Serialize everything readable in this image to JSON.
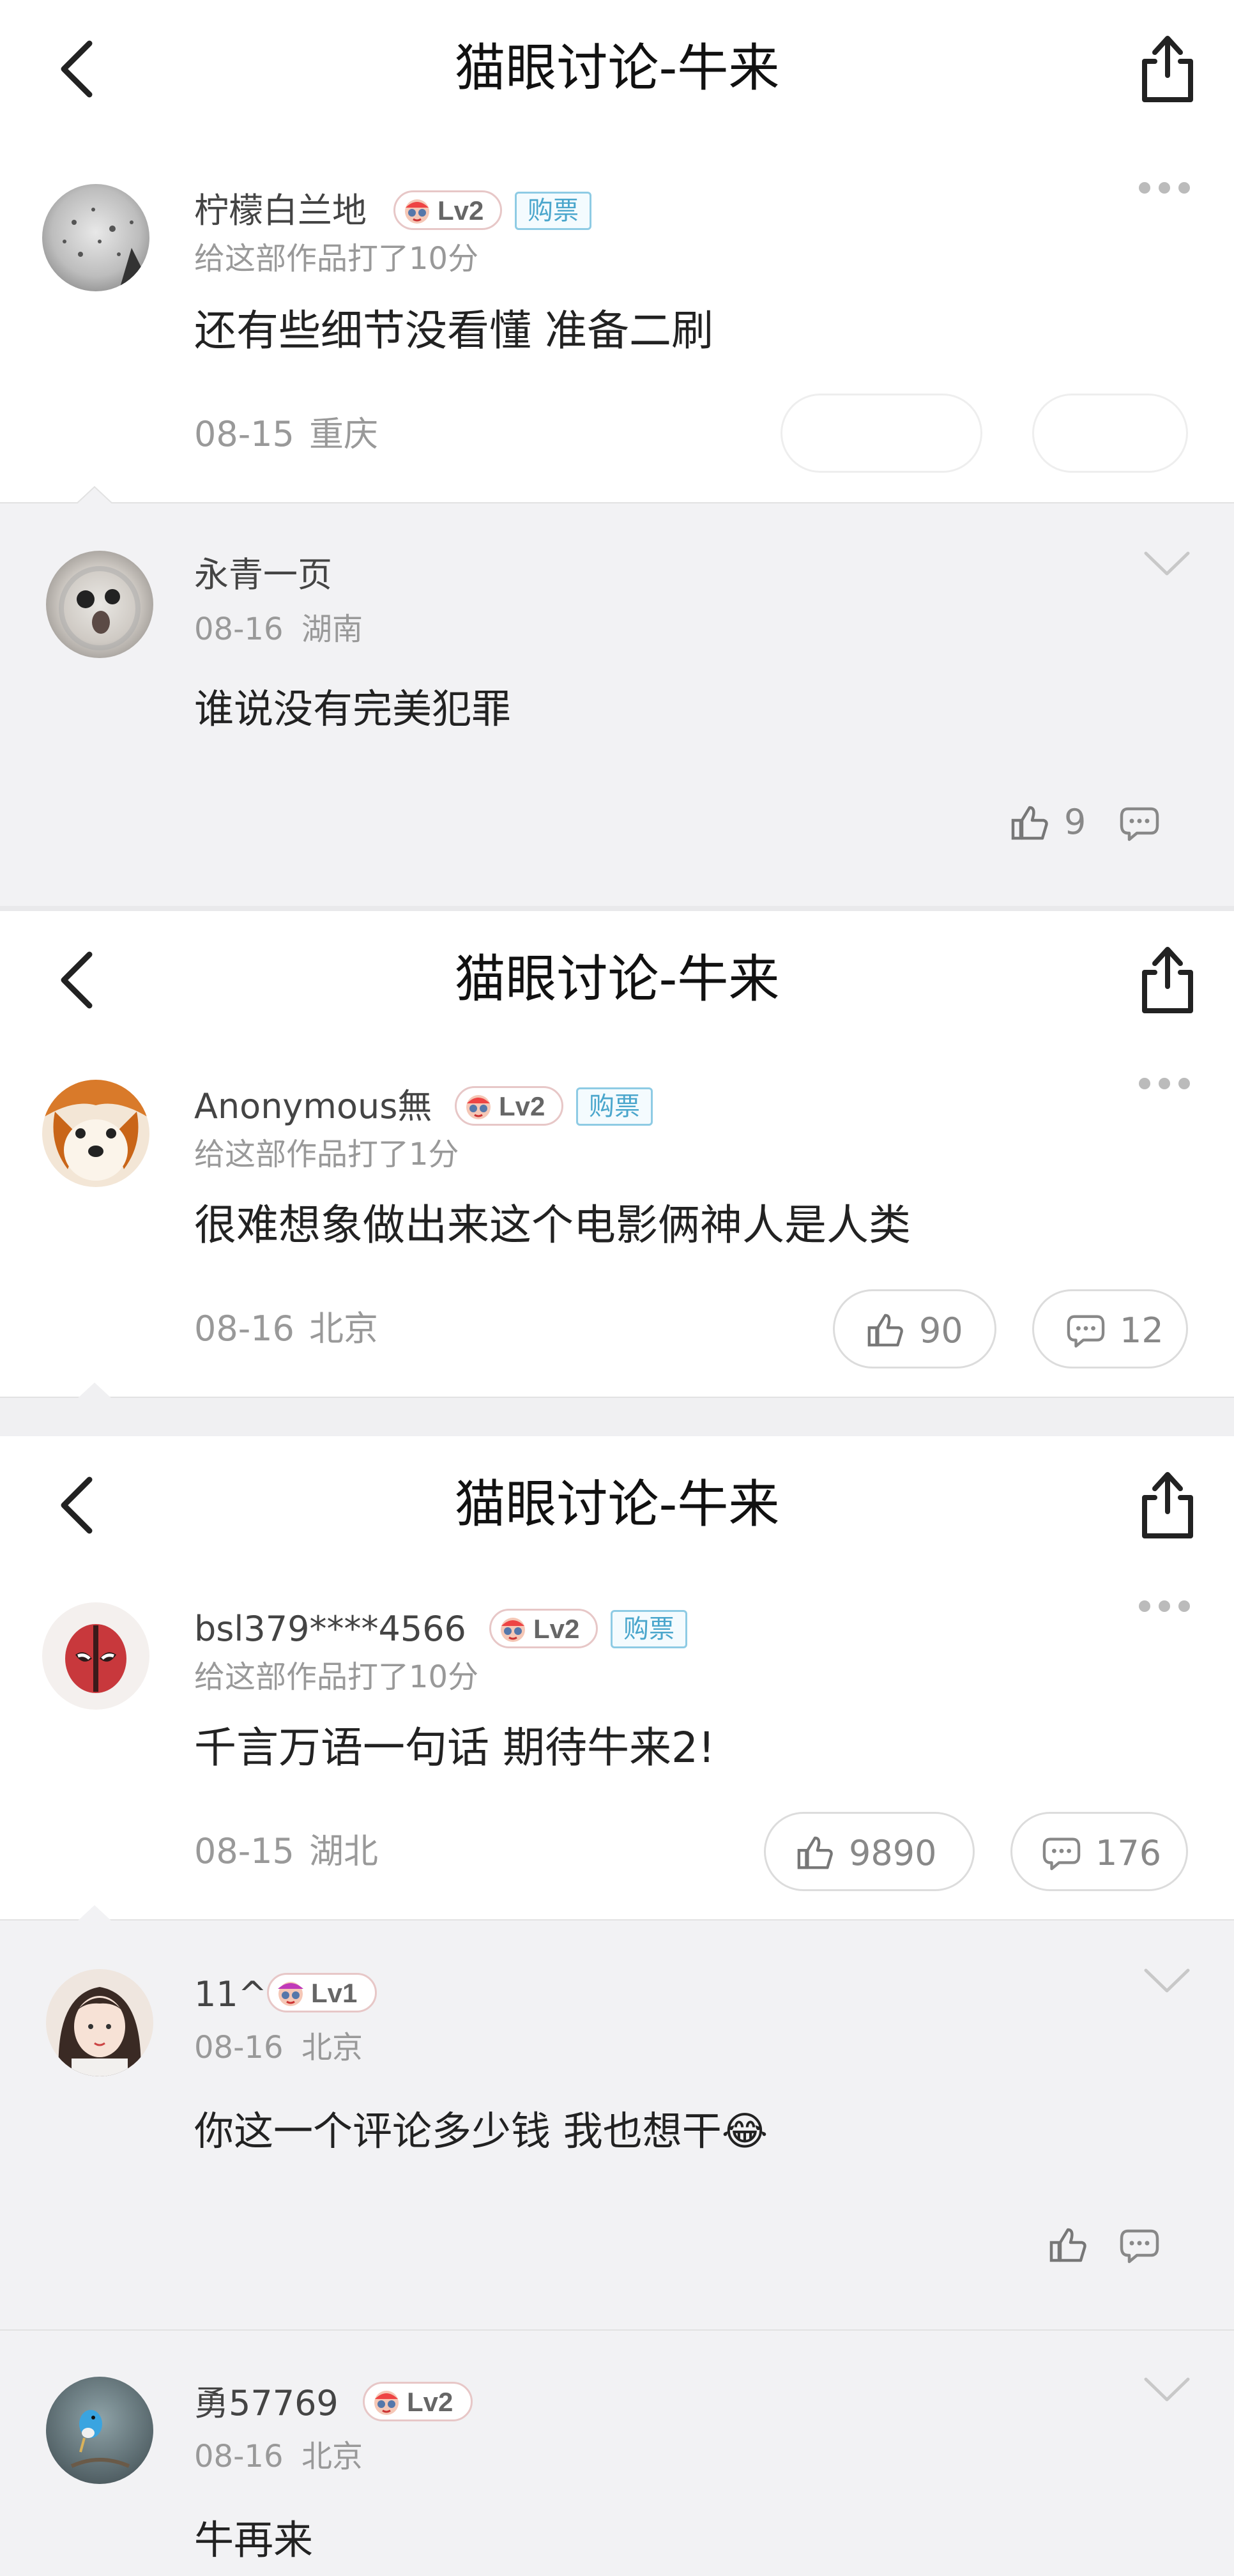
{
  "sections": [
    {
      "title": "猫眼讨论-牛来",
      "main": {
        "user": "柠檬白兰地",
        "level": "Lv2",
        "ticket": "购票",
        "rating": "给这部作品打了10分",
        "content": "还有些细节没看懂 准备二刷",
        "date": "08-15",
        "city": "重庆"
      },
      "replies": [
        {
          "user": "永青一页",
          "date": "08-16",
          "city": "湖南",
          "content": "谁说没有完美犯罪",
          "likes": "9"
        }
      ]
    },
    {
      "title": "猫眼讨论-牛来",
      "main": {
        "user": "Anonymous無",
        "level": "Lv2",
        "ticket": "购票",
        "rating": "给这部作品打了1分",
        "content": "很难想象做出来这个电影俩神人是人类",
        "date": "08-16",
        "city": "北京",
        "likes": "90",
        "comments": "12"
      }
    },
    {
      "title": "猫眼讨论-牛来",
      "main": {
        "user": "bsl379****4566",
        "level": "Lv2",
        "ticket": "购票",
        "rating": "给这部作品打了10分",
        "content": "千言万语一句话 期待牛来2!",
        "date": "08-15",
        "city": "湖北",
        "likes": "9890",
        "comments": "176"
      },
      "replies": [
        {
          "user": "11^",
          "level": "Lv1",
          "date": "08-16",
          "city": "北京",
          "content": "你这一个评论多少钱 我也想干😂"
        },
        {
          "user": "勇57769",
          "level": "Lv2",
          "date": "08-16",
          "city": "北京",
          "content": "牛再来"
        }
      ]
    }
  ]
}
